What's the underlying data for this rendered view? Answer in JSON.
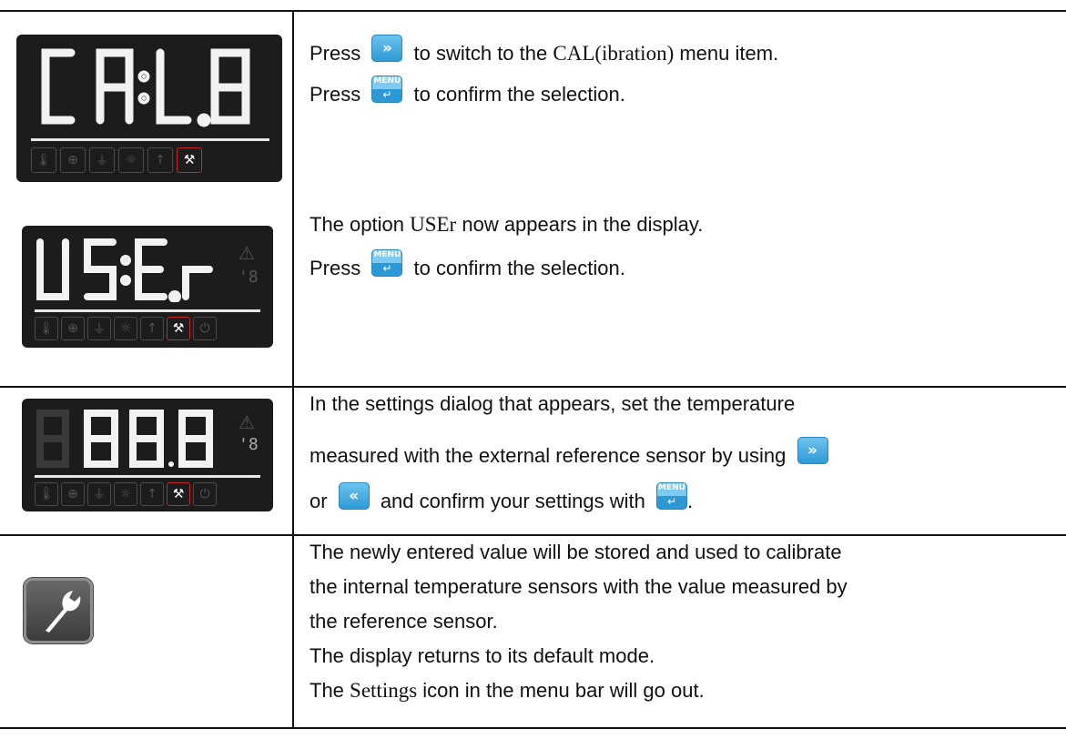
{
  "rows": [
    {
      "lines": [
        {
          "a": "Press",
          "b": "to switch to the",
          "c": "CAL(ibration)",
          "d": "menu item."
        },
        {
          "a": "Press",
          "b": "to confirm the selection."
        }
      ],
      "display": {
        "digits": "CAL8"
      }
    },
    {
      "lines": [
        {
          "a": "The option",
          "b": "USEr",
          "c": "now appears in the display."
        },
        {
          "a": "Press",
          "b": "to confirm the selection."
        }
      ],
      "display": {
        "digits": "USEr"
      }
    },
    {
      "lines": [
        {
          "a": "In the settings dialog that appears, set the temperature"
        },
        {
          "a": "measured with the external reference sensor by using"
        },
        {
          "a": "or",
          "b": "and confirm your settings with",
          "c": "."
        }
      ],
      "display": {
        "digits": "88.8"
      }
    },
    {
      "lines": [
        {
          "a": "The newly entered value will be stored and used to calibrate"
        },
        {
          "a": "the internal temperature sensors with the value measured by"
        },
        {
          "a": "the reference sensor."
        },
        {
          "a": "The display returns to its default mode."
        },
        {
          "a": "The",
          "b": "Settings",
          "c": "icon in the menu bar will go out."
        }
      ]
    }
  ],
  "keys": {
    "menu_label": "MENU",
    "menu_return": "↵",
    "next": "»",
    "prev": "«"
  },
  "colors": {
    "key_blue": "#2c98d4",
    "display_bg": "#1c1c1c",
    "active_red": "#c62828"
  }
}
